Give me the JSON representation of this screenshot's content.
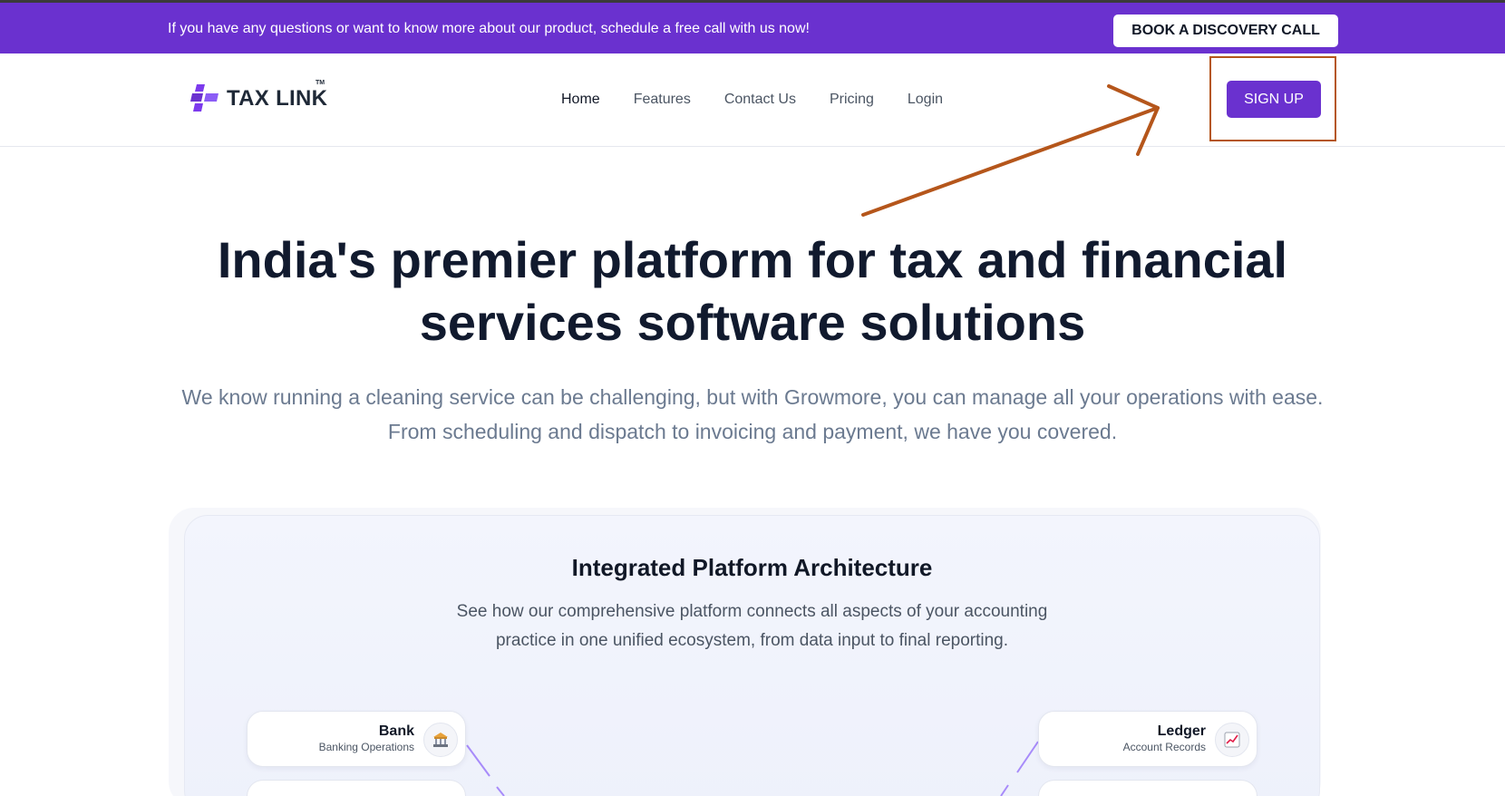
{
  "announcement": {
    "text": "If you have any questions or want to know more about our product, schedule a free call with us now!",
    "button_label": "BOOK A DISCOVERY CALL"
  },
  "nav": {
    "logo_text": "TAX LINK",
    "logo_tm": "TM",
    "links": [
      {
        "label": "Home",
        "active": true
      },
      {
        "label": "Features"
      },
      {
        "label": "Contact Us"
      },
      {
        "label": "Pricing"
      },
      {
        "label": "Login"
      }
    ],
    "signup_label": "SIGN UP"
  },
  "hero": {
    "title_line1": "India's premier platform for tax and financial",
    "title_line2": "services software solutions",
    "subtitle_line1": "We know running a cleaning service can be challenging, but with Growmore, you can manage all your operations with ease.",
    "subtitle_line2": "From scheduling and dispatch to invoicing and payment, we have you covered."
  },
  "architecture": {
    "title": "Integrated Platform Architecture",
    "subtitle_line1": "See how our comprehensive platform connects all aspects of your accounting",
    "subtitle_line2": "practice in one unified ecosystem, from data input to final reporting.",
    "nodes": [
      {
        "name": "Bank",
        "desc": "Banking Operations",
        "icon": "bank-icon"
      },
      {
        "name": "Ledger",
        "desc": "Account Records",
        "icon": "chart-icon"
      }
    ]
  },
  "colors": {
    "brand": "#6a31cf",
    "annotation": "#b5561b",
    "heading": "#111a2e"
  }
}
